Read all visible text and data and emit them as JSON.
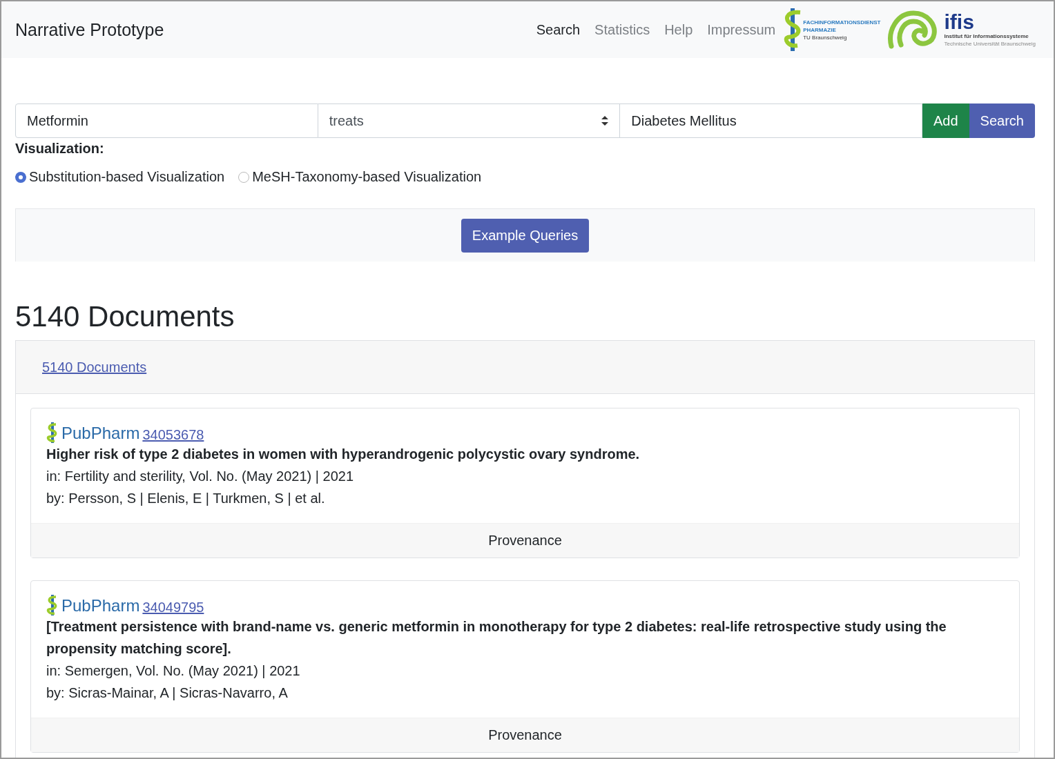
{
  "navbar": {
    "brand": "Narrative Prototype",
    "links": [
      {
        "label": "Search",
        "selected": true
      },
      {
        "label": "Statistics",
        "selected": false
      },
      {
        "label": "Help",
        "selected": false
      },
      {
        "label": "Impressum",
        "selected": false
      }
    ],
    "logos": {
      "fid": {
        "lines": [
          "FACHINFORMATIONSDIENST",
          "PHARMAZIE",
          "TU Braunschweig"
        ]
      },
      "ifis": {
        "name": "ifis",
        "lines": [
          "Institut für Informationssysteme",
          "Technische Universität Braunschweig"
        ]
      }
    }
  },
  "query": {
    "subject": "Metformin",
    "predicate": "treats",
    "object": "Diabetes Mellitus",
    "buttons": [
      "Add",
      "Search"
    ]
  },
  "visualization": {
    "label": "Visualization:",
    "options": [
      {
        "label": "Substitution-based Visualization",
        "selected": true
      },
      {
        "label": "MeSH-Taxonomy-based Visualization",
        "selected": false
      }
    ]
  },
  "example_button": "Example Queries",
  "results": {
    "heading": "5140 Documents",
    "tab_link": "5140 Documents",
    "documents": [
      {
        "source": "PubPharm",
        "id": "34053678",
        "title": "Higher risk of type 2 diabetes in women with hyperandrogenic polycystic ovary syndrome.",
        "journal": "in: Fertility and sterility, Vol. No. (May 2021) | 2021",
        "authors": "by: Persson, S | Elenis, E | Turkmen, S | et al.",
        "button": "Provenance"
      },
      {
        "source": "PubPharm",
        "id": "34049795",
        "title": "[Treatment persistence with brand-name vs. generic metformin in monotherapy for type 2 diabetes: real-life retrospective study using the propensity matching score].",
        "journal": "in: Semergen, Vol. No. (May 2021) | 2021",
        "authors": "by: Sicras-Mainar, A | Sicras-Navarro, A",
        "button": "Provenance"
      }
    ]
  }
}
